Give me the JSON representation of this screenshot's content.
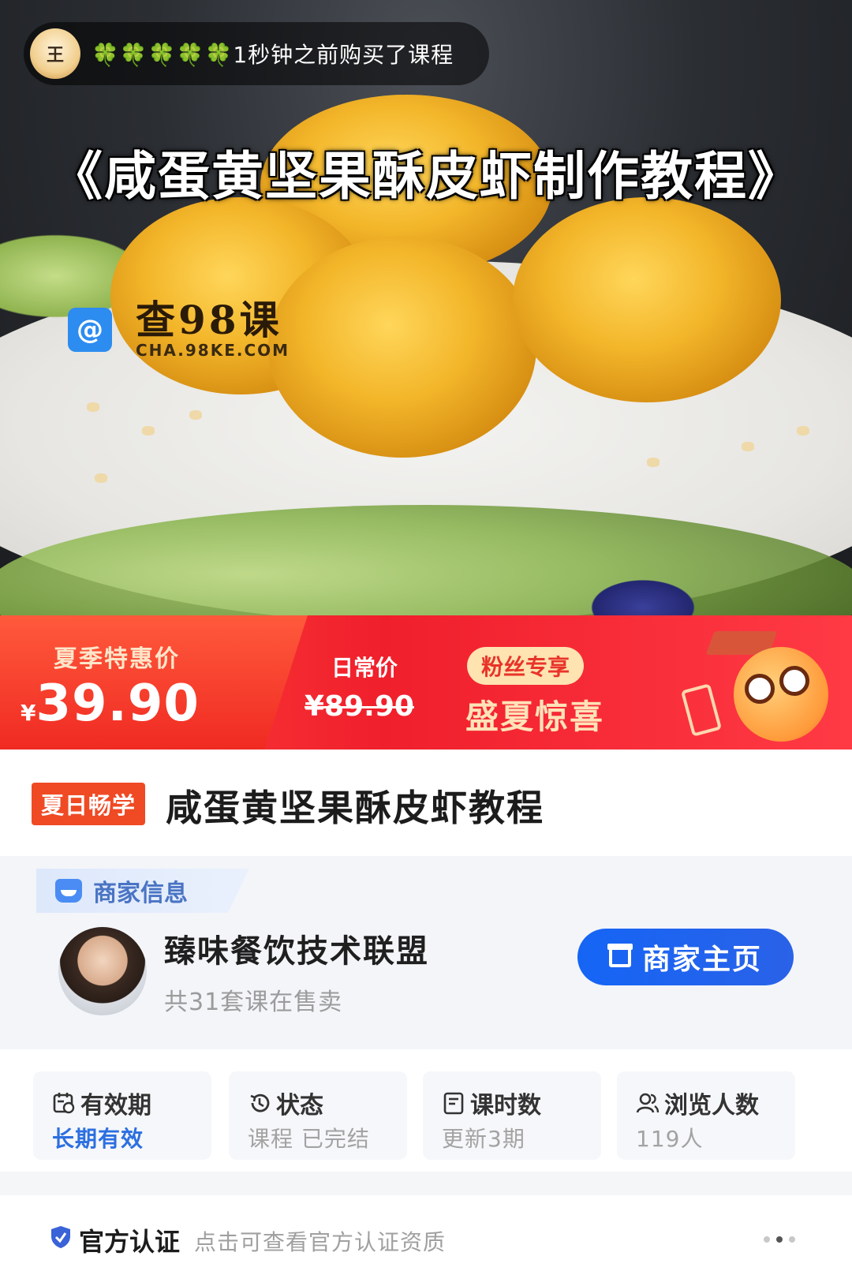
{
  "toast": {
    "clovers": "🍀🍀🍀🍀🍀",
    "message": "1秒钟之前购买了课程",
    "avatar_text": "王"
  },
  "hero": {
    "title": "《咸蛋黄坚果酥皮虾制作教程》",
    "watermark_main": "查98课",
    "watermark_sub": "CHA.98KE.COM"
  },
  "promo": {
    "sale_label": "夏季特惠价",
    "currency": "¥",
    "sale_price": "39.90",
    "regular_label": "日常价",
    "regular_price": "¥89.90",
    "fan_badge": "粉丝专享",
    "slogan": "盛夏惊喜"
  },
  "course": {
    "tag": "夏日畅学",
    "title": "咸蛋黄坚果酥皮虾教程"
  },
  "merchant": {
    "section_label": "商家信息",
    "name": "臻味餐饮技术联盟",
    "course_count": "共31套课在售卖",
    "shop_button": "商家主页"
  },
  "stats": [
    {
      "label": "有效期",
      "value": "长期有效",
      "icon": "calendar-icon"
    },
    {
      "label": "状态",
      "value": "课程 已完结",
      "icon": "history-icon"
    },
    {
      "label": "课时数",
      "value": "更新3期",
      "icon": "document-icon"
    },
    {
      "label": "浏览人数",
      "value": "119人",
      "icon": "users-icon"
    }
  ],
  "footer": {
    "official_label": "官方认证",
    "official_desc": "点击可查看官方认证资质"
  },
  "colors": {
    "promo_red": "#f01f2c",
    "brand_blue": "#1565f5",
    "tag_orange": "#ef4a24"
  }
}
